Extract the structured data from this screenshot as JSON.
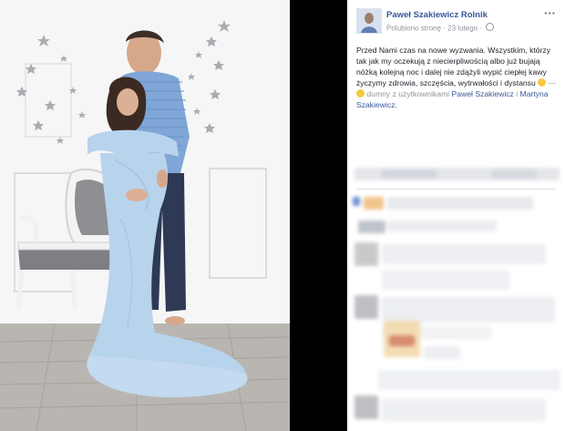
{
  "post": {
    "page_name": "Paweł Szakiewicz Rolnik",
    "liked_label": "Polubiono stronę",
    "date_label": "23 lutego",
    "more_label": "···",
    "text_main": "Przed Nami czas na nowe wyzwania. Wszystkim, którzy tak jak my oczekują z niecierpliwością albo już bujają nóżką kolejną noc i dalej nie zdążyli wypić ciepłej kawy życzymy zdrowia, szczęścia, wytrwałości i dystansu",
    "text_feeling": "dumny z użytkownikami",
    "tag_1": "Paweł Szakiewicz",
    "tag_separator": "i",
    "tag_2": "Martyna Szakiewicz."
  },
  "icons": {
    "emoji_1": "smile-emoji-icon",
    "emoji_2": "laugh-emoji-icon",
    "globe": "globe-icon",
    "more": "more-options-icon"
  },
  "colors": {
    "link": "#365899",
    "muted": "#90949c",
    "text": "#1d2129",
    "dress": "#b8d3ec",
    "background": "#000000"
  }
}
